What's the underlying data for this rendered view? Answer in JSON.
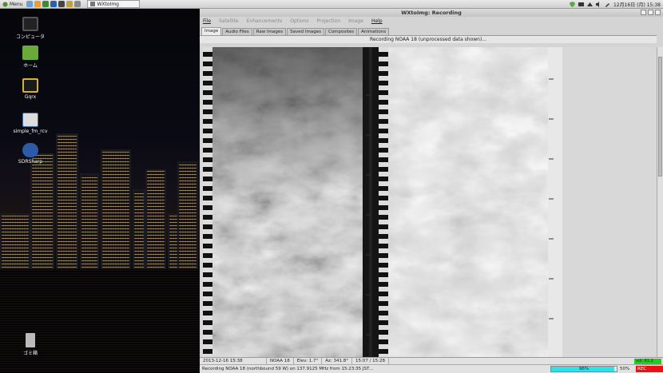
{
  "top_panel": {
    "menu_label": "Menu",
    "task_label": "WXtoImg",
    "clock": "12月16日 (月) 15:38"
  },
  "desktop": {
    "icons": [
      {
        "label": "コンピュータ",
        "icon": "computer-icon"
      },
      {
        "label": "ホーム",
        "icon": "home-folder-icon"
      },
      {
        "label": "Gqrx",
        "icon": "gqrx-icon"
      },
      {
        "label": "simple_fm_rcv",
        "icon": "python-script-icon"
      },
      {
        "label": "SDRSharp",
        "icon": "sdrsharp-icon"
      },
      {
        "label": "ゴミ箱",
        "icon": "trash-icon"
      }
    ]
  },
  "window": {
    "title": "WXtoImg: Recording",
    "menu": [
      {
        "label": "File",
        "enabled": true
      },
      {
        "label": "Satellite",
        "enabled": false
      },
      {
        "label": "Enhancements",
        "enabled": false
      },
      {
        "label": "Options",
        "enabled": false
      },
      {
        "label": "Projection",
        "enabled": false
      },
      {
        "label": "Image",
        "enabled": false
      },
      {
        "label": "Help",
        "enabled": true
      }
    ],
    "tabs": [
      "Image",
      "Audio Files",
      "Raw Images",
      "Saved Images",
      "Composites",
      "Animations"
    ],
    "active_tab": "Image",
    "status": "Recording NOAA 18 (unprocessed data shown)...",
    "info": {
      "datetime": "2013-12-16  15:38",
      "satellite": "NOAA 18",
      "elevation": "Elev:  1.7°",
      "azimuth": "Az:  341.8°",
      "pass_time": "15:07 / 15:28"
    },
    "recording_text": "Recording NOAA 18 (northbound 59 W) on 137.9125 MHz from 15:23:35 JST...",
    "progress_percent": 96,
    "progress_label": "96%",
    "secondary_label": "50%",
    "rec_label": "REC",
    "volume_label": "vol: 61.2"
  },
  "colors": {
    "progress": "#33e0e8",
    "rec": "#ee1111",
    "volume": "#22cc22"
  }
}
